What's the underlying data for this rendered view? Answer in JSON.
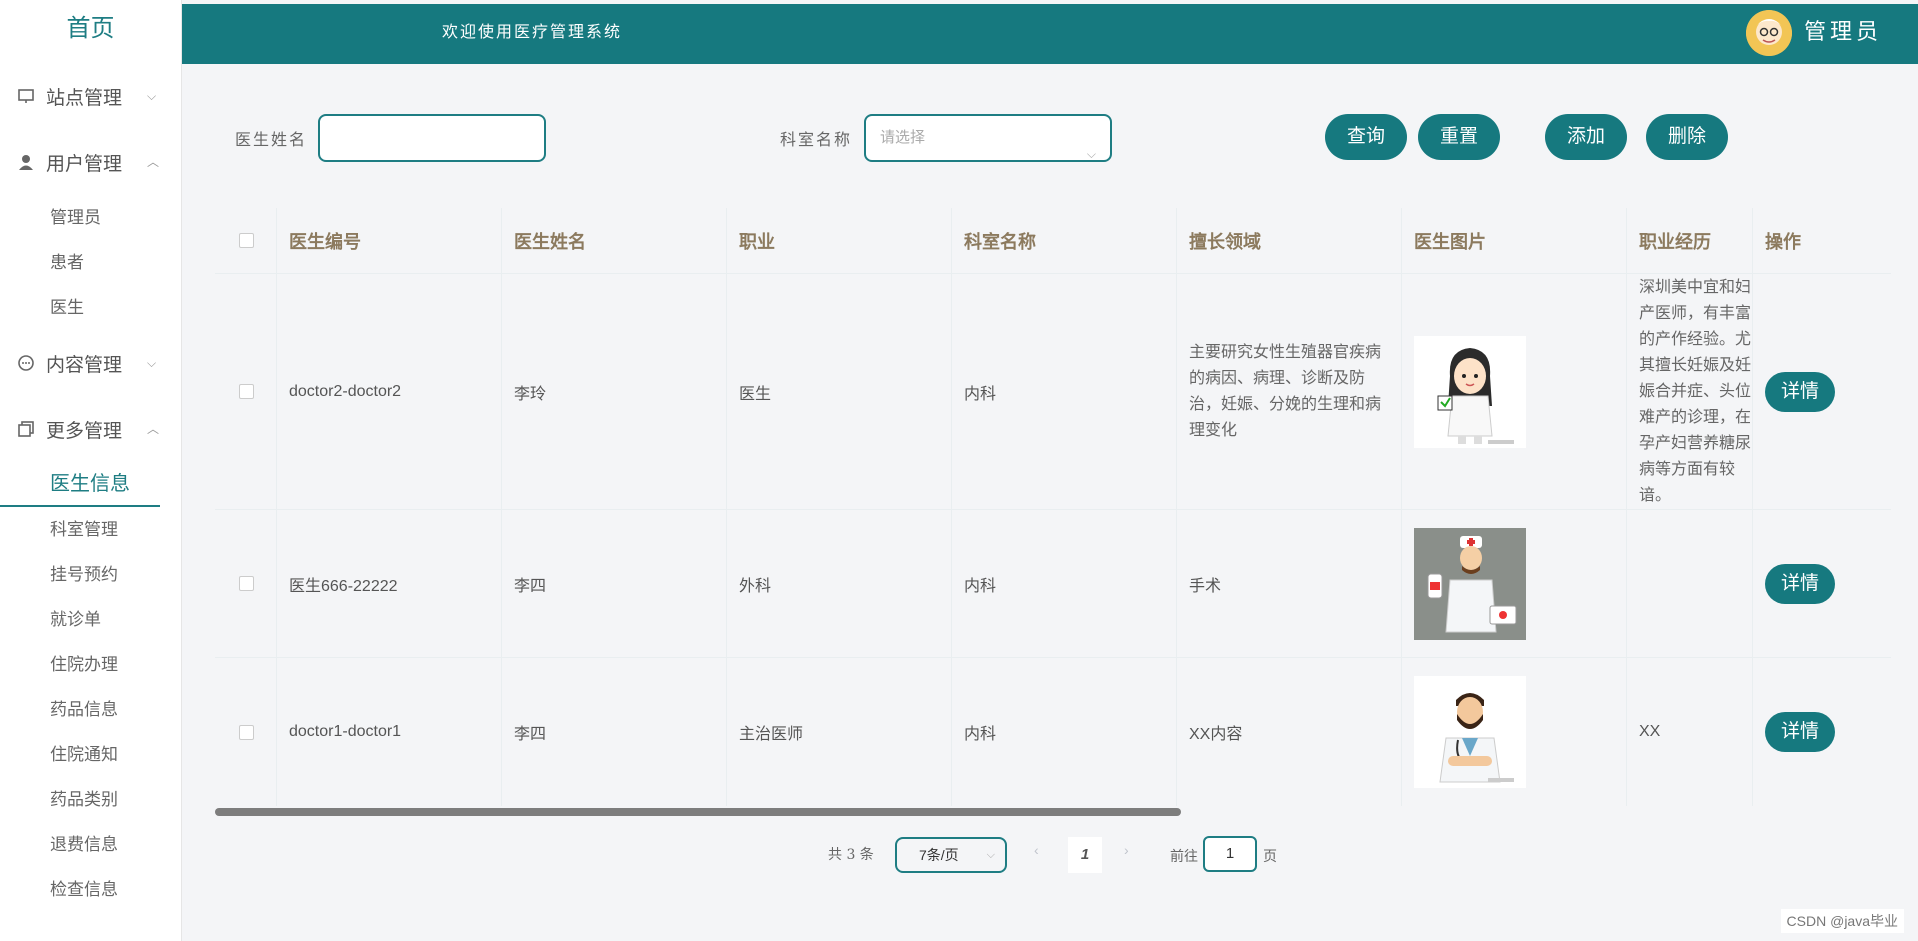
{
  "sidebar": {
    "home": "首页",
    "groups": {
      "site": "站点管理",
      "users": "用户管理",
      "content": "内容管理",
      "more": "更多管理"
    },
    "user_items": [
      "管理员",
      "患者",
      "医生"
    ],
    "more_items": [
      "医生信息",
      "科室管理",
      "挂号预约",
      "就诊单",
      "住院办理",
      "药品信息",
      "住院通知",
      "药品类别",
      "退费信息",
      "检查信息"
    ]
  },
  "header": {
    "welcome": "欢迎使用医疗管理系统",
    "user": "管理员"
  },
  "search": {
    "doctor_name_label": "医生姓名",
    "doctor_name_value": "",
    "dept_label": "科室名称",
    "dept_placeholder": "请选择",
    "query": "查询",
    "reset": "重置",
    "add": "添加",
    "delete": "删除"
  },
  "table": {
    "headers": [
      "医生编号",
      "医生姓名",
      "职业",
      "科室名称",
      "擅长领域",
      "医生图片",
      "职业经历",
      "操作"
    ],
    "rows": [
      {
        "id": "doctor2-doctor2",
        "name": "李玲",
        "job": "医生",
        "dept": "内科",
        "specialty": "主要研究女性生殖器官疾病的病因、病理、诊断及防治，妊娠、分娩的生理和病理变化",
        "experience": "深圳美中宜和妇产医师，有丰富的产作经验。尤其擅长妊娠及妊娠合并症、头位难产的诊理，在孕产妇营养糖尿病等方面有较谙。",
        "action": "详情"
      },
      {
        "id": "医生666-22222",
        "name": "李四",
        "job": "外科",
        "dept": "内科",
        "specialty": "手术",
        "experience": "",
        "action": "详情"
      },
      {
        "id": "doctor1-doctor1",
        "name": "李四",
        "job": "主治医师",
        "dept": "内科",
        "specialty": "XX内容",
        "experience": "XX",
        "action": "详情"
      }
    ]
  },
  "pager": {
    "total": "共 3 条",
    "page_size": "7条/页",
    "current": "1",
    "goto": "前往",
    "goto_value": "1",
    "page_unit": "页"
  },
  "watermark": "CSDN @java毕业"
}
